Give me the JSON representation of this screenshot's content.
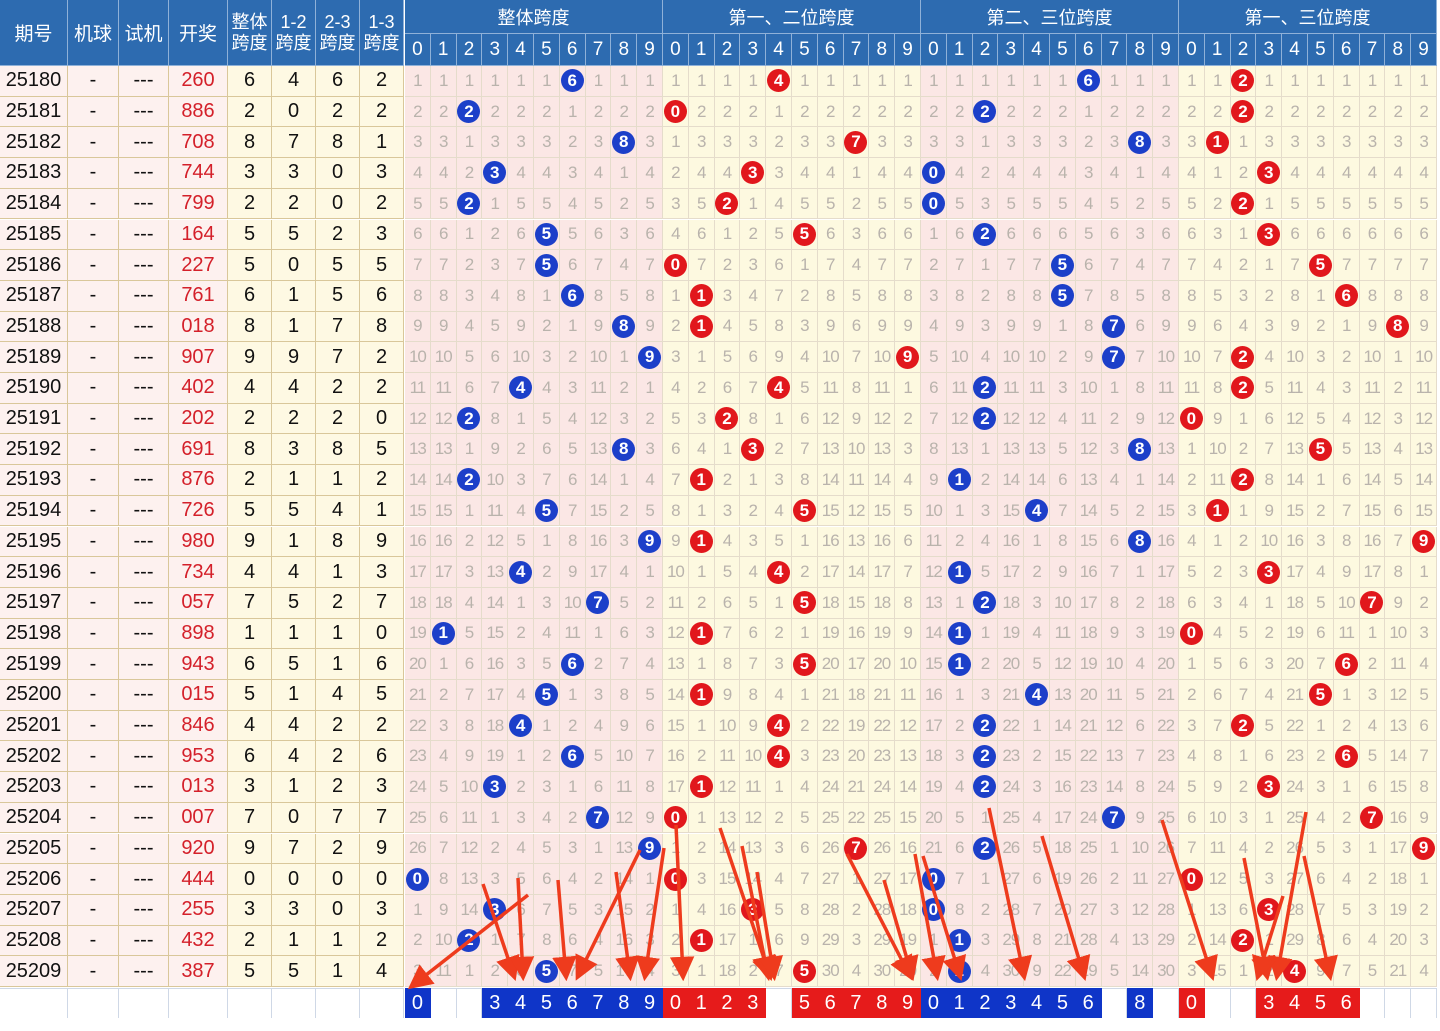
{
  "headers": {
    "issue": "期号",
    "machine_ball": "机球",
    "trial": "试机",
    "draw": "开奖",
    "total_span": [
      "整体",
      "跨度"
    ],
    "span_12": [
      "1-2",
      "跨度"
    ],
    "span_23": [
      "2-3",
      "跨度"
    ],
    "span_13": [
      "1-3",
      "跨度"
    ]
  },
  "groups": [
    {
      "title": "整体跨度",
      "color": "blue"
    },
    {
      "title": "第一、二位跨度",
      "color": "red"
    },
    {
      "title": "第二、三位跨度",
      "color": "blue"
    },
    {
      "title": "第一、三位跨度",
      "color": "red"
    }
  ],
  "digits": [
    "0",
    "1",
    "2",
    "3",
    "4",
    "5",
    "6",
    "7",
    "8",
    "9"
  ],
  "colors": {
    "header": "#2d6bb0",
    "blue_ball": "#1c3fc9",
    "red_ball": "#e1171c",
    "arrow": "#ee3b1d"
  },
  "rows": [
    {
      "issue": "25180",
      "mach": "-",
      "shi": "---",
      "kj": "260",
      "sp": [
        6,
        4,
        6,
        2
      ]
    },
    {
      "issue": "25181",
      "mach": "-",
      "shi": "---",
      "kj": "886",
      "sp": [
        2,
        0,
        2,
        2
      ]
    },
    {
      "issue": "25182",
      "mach": "-",
      "shi": "---",
      "kj": "708",
      "sp": [
        8,
        7,
        8,
        1
      ]
    },
    {
      "issue": "25183",
      "mach": "-",
      "shi": "---",
      "kj": "744",
      "sp": [
        3,
        3,
        0,
        3
      ]
    },
    {
      "issue": "25184",
      "mach": "-",
      "shi": "---",
      "kj": "799",
      "sp": [
        2,
        2,
        0,
        2
      ]
    },
    {
      "issue": "25185",
      "mach": "-",
      "shi": "---",
      "kj": "164",
      "sp": [
        5,
        5,
        2,
        3
      ]
    },
    {
      "issue": "25186",
      "mach": "-",
      "shi": "---",
      "kj": "227",
      "sp": [
        5,
        0,
        5,
        5
      ]
    },
    {
      "issue": "25187",
      "mach": "-",
      "shi": "---",
      "kj": "761",
      "sp": [
        6,
        1,
        5,
        6
      ]
    },
    {
      "issue": "25188",
      "mach": "-",
      "shi": "---",
      "kj": "018",
      "sp": [
        8,
        1,
        7,
        8
      ]
    },
    {
      "issue": "25189",
      "mach": "-",
      "shi": "---",
      "kj": "907",
      "sp": [
        9,
        9,
        7,
        2
      ]
    },
    {
      "issue": "25190",
      "mach": "-",
      "shi": "---",
      "kj": "402",
      "sp": [
        4,
        4,
        2,
        2
      ]
    },
    {
      "issue": "25191",
      "mach": "-",
      "shi": "---",
      "kj": "202",
      "sp": [
        2,
        2,
        2,
        0
      ]
    },
    {
      "issue": "25192",
      "mach": "-",
      "shi": "---",
      "kj": "691",
      "sp": [
        8,
        3,
        8,
        5
      ]
    },
    {
      "issue": "25193",
      "mach": "-",
      "shi": "---",
      "kj": "876",
      "sp": [
        2,
        1,
        1,
        2
      ]
    },
    {
      "issue": "25194",
      "mach": "-",
      "shi": "---",
      "kj": "726",
      "sp": [
        5,
        5,
        4,
        1
      ]
    },
    {
      "issue": "25195",
      "mach": "-",
      "shi": "---",
      "kj": "980",
      "sp": [
        9,
        1,
        8,
        9
      ]
    },
    {
      "issue": "25196",
      "mach": "-",
      "shi": "---",
      "kj": "734",
      "sp": [
        4,
        4,
        1,
        3
      ]
    },
    {
      "issue": "25197",
      "mach": "-",
      "shi": "---",
      "kj": "057",
      "sp": [
        7,
        5,
        2,
        7
      ]
    },
    {
      "issue": "25198",
      "mach": "-",
      "shi": "---",
      "kj": "898",
      "sp": [
        1,
        1,
        1,
        0
      ]
    },
    {
      "issue": "25199",
      "mach": "-",
      "shi": "---",
      "kj": "943",
      "sp": [
        6,
        5,
        1,
        6
      ]
    },
    {
      "issue": "25200",
      "mach": "-",
      "shi": "---",
      "kj": "015",
      "sp": [
        5,
        1,
        4,
        5
      ]
    },
    {
      "issue": "25201",
      "mach": "-",
      "shi": "---",
      "kj": "846",
      "sp": [
        4,
        4,
        2,
        2
      ]
    },
    {
      "issue": "25202",
      "mach": "-",
      "shi": "---",
      "kj": "953",
      "sp": [
        6,
        4,
        2,
        6
      ]
    },
    {
      "issue": "25203",
      "mach": "-",
      "shi": "---",
      "kj": "013",
      "sp": [
        3,
        1,
        2,
        3
      ]
    },
    {
      "issue": "25204",
      "mach": "-",
      "shi": "---",
      "kj": "007",
      "sp": [
        7,
        0,
        7,
        7
      ]
    },
    {
      "issue": "25205",
      "mach": "-",
      "shi": "---",
      "kj": "920",
      "sp": [
        9,
        7,
        2,
        9
      ]
    },
    {
      "issue": "25206",
      "mach": "-",
      "shi": "---",
      "kj": "444",
      "sp": [
        0,
        0,
        0,
        0
      ]
    },
    {
      "issue": "25207",
      "mach": "-",
      "shi": "---",
      "kj": "255",
      "sp": [
        3,
        3,
        0,
        3
      ]
    },
    {
      "issue": "25208",
      "mach": "-",
      "shi": "---",
      "kj": "432",
      "sp": [
        2,
        1,
        1,
        2
      ]
    },
    {
      "issue": "25209",
      "mach": "-",
      "shi": "---",
      "kj": "387",
      "sp": [
        5,
        5,
        1,
        4
      ]
    }
  ],
  "footer_predictions": [
    [
      0,
      3,
      4,
      5,
      6,
      7,
      8,
      9
    ],
    [
      0,
      1,
      2,
      3,
      5,
      6,
      7,
      8,
      9
    ],
    [
      0,
      1,
      2,
      3,
      4,
      5,
      6,
      8
    ],
    [
      0,
      3,
      4,
      5,
      6
    ]
  ]
}
